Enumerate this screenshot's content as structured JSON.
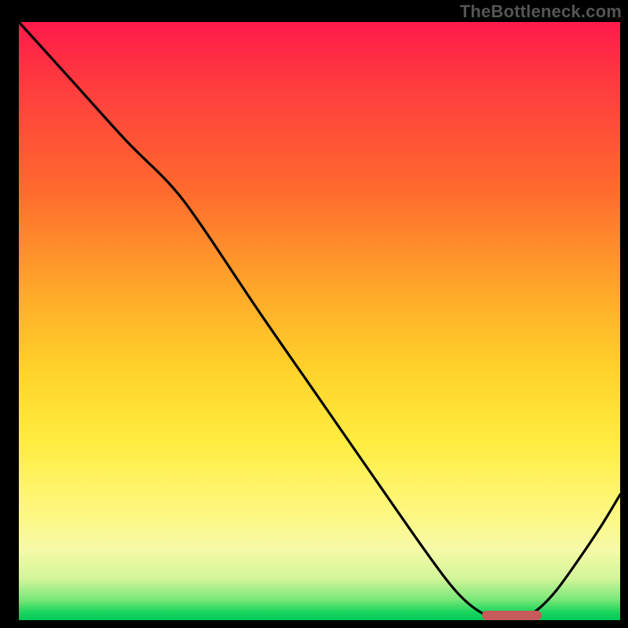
{
  "watermark": "TheBottleneck.com",
  "colors": {
    "frame": "#000000",
    "curve": "#000000",
    "marker": "#c75a5a",
    "gradient_stops": [
      "#ff1a4b",
      "#ff3a3f",
      "#ff6a2e",
      "#ffa82a",
      "#ffd22a",
      "#ffec3f",
      "#fff674",
      "#f7faa6",
      "#d3f59a",
      "#7be87a",
      "#1fd65e",
      "#00c95a"
    ]
  },
  "chart_data": {
    "type": "line",
    "title": "",
    "xlabel": "",
    "ylabel": "",
    "x_range": [
      0,
      100
    ],
    "y_range": [
      0,
      100
    ],
    "note": "x and y are percentages of the plot area (0 = left/bottom, 100 = right/top). Curve starts near top-left, descends, flattens near bottom around x≈77–85, then rises toward right edge.",
    "series": [
      {
        "name": "curve",
        "points": [
          {
            "x": 0.0,
            "y": 100.0
          },
          {
            "x": 9.0,
            "y": 90.0
          },
          {
            "x": 18.0,
            "y": 80.0
          },
          {
            "x": 25.0,
            "y": 73.0
          },
          {
            "x": 30.0,
            "y": 66.5
          },
          {
            "x": 40.0,
            "y": 51.5
          },
          {
            "x": 50.0,
            "y": 37.0
          },
          {
            "x": 60.0,
            "y": 22.5
          },
          {
            "x": 68.0,
            "y": 11.0
          },
          {
            "x": 73.0,
            "y": 4.5
          },
          {
            "x": 77.0,
            "y": 1.2
          },
          {
            "x": 80.0,
            "y": 0.6
          },
          {
            "x": 83.0,
            "y": 0.6
          },
          {
            "x": 85.5,
            "y": 1.2
          },
          {
            "x": 89.0,
            "y": 4.5
          },
          {
            "x": 93.0,
            "y": 10.0
          },
          {
            "x": 97.0,
            "y": 16.0
          },
          {
            "x": 100.0,
            "y": 21.0
          }
        ]
      }
    ],
    "marker": {
      "name": "highlight-bar",
      "x_start": 77.0,
      "x_end": 87.0,
      "y": 0.8
    }
  }
}
